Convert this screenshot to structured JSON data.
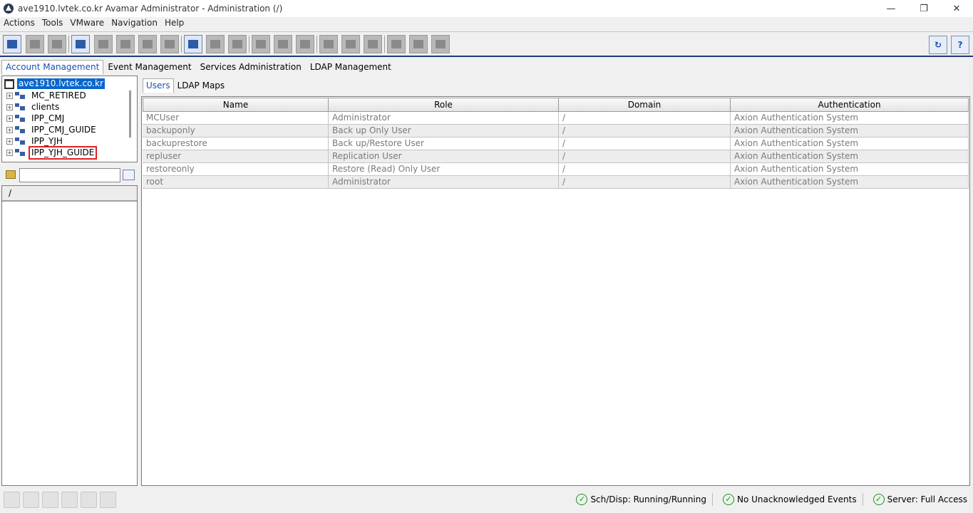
{
  "window": {
    "title": "ave1910.lvtek.co.kr Avamar Administrator - Administration (/)"
  },
  "menu": [
    "Actions",
    "Tools",
    "VMware",
    "Navigation",
    "Help"
  ],
  "main_tabs": [
    "Account Management",
    "Event Management",
    "Services Administration",
    "LDAP Management"
  ],
  "tree": {
    "root": "ave1910.lvtek.co.kr",
    "items": [
      "MC_RETIRED",
      "clients",
      "IPP_CMJ",
      "IPP_CMJ_GUIDE",
      "IPP_YJH",
      "IPP_YJH_GUIDE"
    ],
    "highlighted": "IPP_YJH_GUIDE"
  },
  "filter": {
    "value": ""
  },
  "domain_list": {
    "header": "/"
  },
  "sub_tabs": [
    "Users",
    "LDAP Maps"
  ],
  "users_table": {
    "columns": [
      "Name",
      "Role",
      "Domain",
      "Authentication"
    ],
    "rows": [
      [
        "MCUser",
        "Administrator",
        "/",
        "Axion Authentication System"
      ],
      [
        "backuponly",
        "Back up Only User",
        "/",
        "Axion Authentication System"
      ],
      [
        "backuprestore",
        "Back up/Restore User",
        "/",
        "Axion Authentication System"
      ],
      [
        "repluser",
        "Replication User",
        "/",
        "Axion Authentication System"
      ],
      [
        "restoreonly",
        "Restore (Read) Only User",
        "/",
        "Axion Authentication System"
      ],
      [
        "root",
        "Administrator",
        "/",
        "Axion Authentication System"
      ]
    ]
  },
  "status": {
    "sched": "Sch/Disp: Running/Running",
    "events": "No Unacknowledged Events",
    "server": "Server: Full Access"
  },
  "colors": {
    "accent": "#1b4fb0",
    "selection": "#0a66cc",
    "highlight_box": "#e02020",
    "ok": "#2d8b2d"
  }
}
